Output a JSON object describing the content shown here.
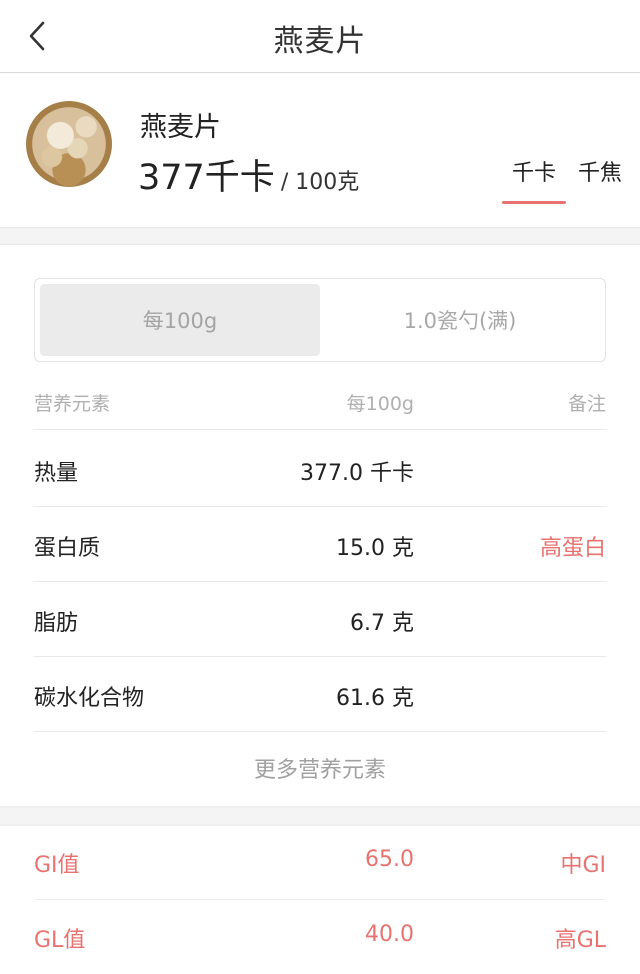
{
  "nav": {
    "title": "燕麦片"
  },
  "food": {
    "name": "燕麦片",
    "calories": "377千卡",
    "per": "/ 100克"
  },
  "unit_tabs": [
    {
      "label": "千卡",
      "active": true
    },
    {
      "label": "千焦",
      "active": false
    }
  ],
  "portion": {
    "options": [
      {
        "label": "每100g",
        "selected": true
      },
      {
        "label": "1.0瓷勺(满)",
        "selected": false
      }
    ]
  },
  "table": {
    "headers": {
      "name": "营养元素",
      "per": "每100g",
      "note": "备注"
    },
    "rows": [
      {
        "name": "热量",
        "value": "377.0 千卡",
        "note": ""
      },
      {
        "name": "蛋白质",
        "value": "15.0 克",
        "note": "高蛋白"
      },
      {
        "name": "脂肪",
        "value": "6.7 克",
        "note": ""
      },
      {
        "name": "碳水化合物",
        "value": "61.6 克",
        "note": ""
      }
    ],
    "more": "更多营养元素"
  },
  "glycemic": [
    {
      "name": "GI值",
      "value": "65.0",
      "note": "中GI"
    },
    {
      "name": "GL值",
      "value": "40.0",
      "note": "高GL"
    }
  ],
  "colors": {
    "accent": "#e8726f",
    "divider": "#e8e8e8",
    "section_bg": "#f4f4f4"
  }
}
